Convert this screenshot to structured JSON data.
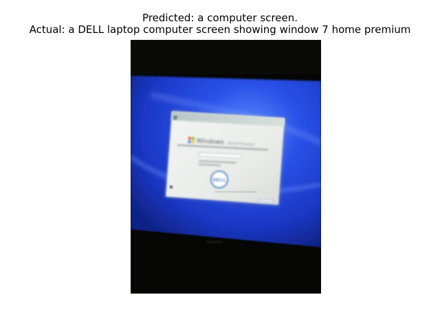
{
  "figure": {
    "predicted_caption": "Predicted: a computer screen.",
    "actual_caption": "Actual: a DELL laptop computer screen  showing window 7 home premium"
  },
  "photo": {
    "screen_color": "#1f3fd0",
    "background_color": "#050604",
    "dialog": {
      "windows_logo_text": "Windows",
      "edition_text": "Home Premium",
      "dell_logo_text": "DELL"
    }
  }
}
